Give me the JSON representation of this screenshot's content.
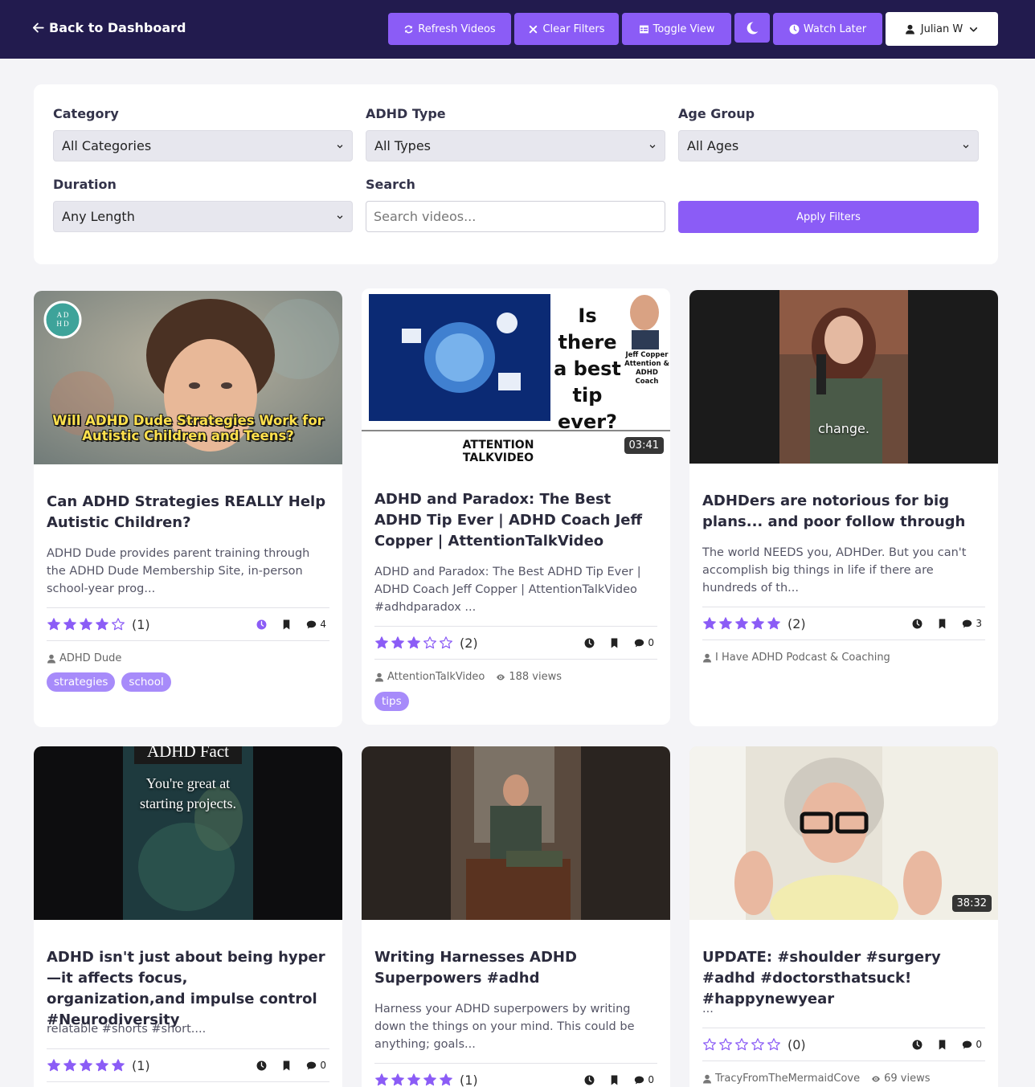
{
  "header": {
    "back_label": "Back to Dashboard",
    "buttons": {
      "refresh": "Refresh Videos",
      "clear": "Clear Filters",
      "toggle": "Toggle View",
      "watch_later": "Watch Later"
    },
    "user_name": "Julian W"
  },
  "filters": {
    "category": {
      "label": "Category",
      "value": "All Categories"
    },
    "adhd_type": {
      "label": "ADHD Type",
      "value": "All Types"
    },
    "age_group": {
      "label": "Age Group",
      "value": "All Ages"
    },
    "duration": {
      "label": "Duration",
      "value": "Any Length"
    },
    "search": {
      "label": "Search",
      "placeholder": "Search videos..."
    },
    "apply_label": "Apply Filters"
  },
  "colors": {
    "accent": "#8b5cf6",
    "header_bg": "#221b4e",
    "star": "#8b5cf6"
  },
  "videos": [
    {
      "thumb_text": "Will ADHD Dude Strategies Work for Autistic Children and Teens?",
      "title": "Can ADHD Strategies REALLY Help Autistic Children?",
      "description": "ADHD Dude provides parent training through the ADHD Dude Membership Site, in-person school-year prog...",
      "rating": 4,
      "rating_count": "(1)",
      "comments": "4",
      "author": "ADHD Dude",
      "views": "",
      "tags": [
        "strategies",
        "school"
      ]
    },
    {
      "thumb_text_1": "Is there a best tip ever?",
      "thumb_text_2": "Jeff Copper Attention & ADHD Coach",
      "thumb_text_3": "ATTENTION TALKVIDEO",
      "duration": "03:41",
      "title": "ADHD and Paradox: The Best ADHD Tip Ever | ADHD Coach Jeff Copper | AttentionTalkVideo",
      "description": "ADHD and Paradox: The Best ADHD Tip Ever | ADHD Coach Jeff Copper | AttentionTalkVideo #adhdparadox ...",
      "rating": 3,
      "rating_count": "(2)",
      "comments": "0",
      "author": "AttentionTalkVideo",
      "views": "188 views",
      "tags": [
        "tips"
      ]
    },
    {
      "thumb_text": "change.",
      "title": "ADHDers are notorious for big plans... and poor follow through",
      "description": "The world NEEDS you, ADHDer. But you can't accomplish big things in life if there are hundreds of th...",
      "rating": 5,
      "rating_count": "(2)",
      "comments": "3",
      "author": "I Have ADHD Podcast & Coaching",
      "views": "",
      "tags": []
    },
    {
      "thumb_text_1": "ADHD Fact",
      "thumb_text_2": "You're great at starting projects.",
      "title": "ADHD isn't just about being hyper—it affects focus, organization,and impulse control #Neurodiversity",
      "description": "relatable #shorts #short....",
      "rating": 5,
      "rating_count": "(1)",
      "comments": "0",
      "author": "",
      "views": "",
      "tags": []
    },
    {
      "title": "Writing Harnesses ADHD Superpowers #adhd",
      "description": "Harness your ADHD superpowers by writing down the things on your mind. This could be anything; goals...",
      "rating": 5,
      "rating_count": "(1)",
      "comments": "0",
      "author": "",
      "views": "",
      "tags": []
    },
    {
      "duration": "38:32",
      "title": "UPDATE: #shoulder #surgery #adhd #doctorsthatsuck! #happynewyear",
      "description": "...",
      "rating": 0,
      "rating_count": "(0)",
      "comments": "0",
      "author": "TracyFromTheMermaidCove",
      "views": "69 views",
      "tags": []
    }
  ]
}
